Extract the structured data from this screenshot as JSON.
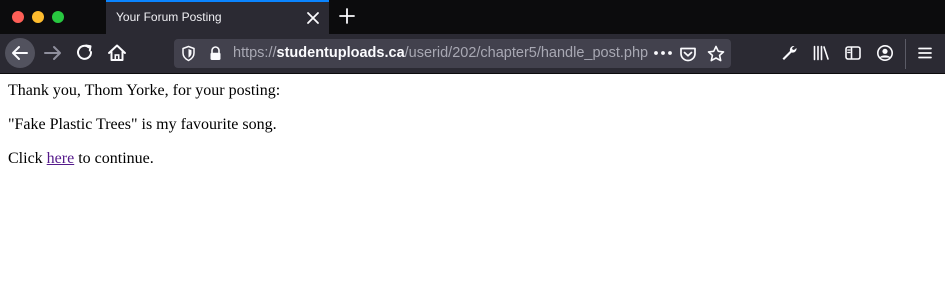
{
  "browser": {
    "tab_title": "Your Forum Posting",
    "url_prefix": "https://",
    "url_host": "studentuploads.ca",
    "url_path": "/userid/202/chapter5/handle_post.php",
    "icons": {
      "back": "back-arrow-icon",
      "forward": "forward-arrow-icon",
      "reload": "reload-icon",
      "home": "home-icon",
      "tracking": "shield-icon",
      "lock": "lock-icon",
      "page_actions": "more-icon",
      "pocket": "pocket-icon",
      "bookmark": "star-icon",
      "tools": "wrench-icon",
      "library": "library-icon",
      "sidebar": "sidebar-icon",
      "account": "account-icon",
      "menu": "hamburger-menu-icon"
    },
    "colors": {
      "accent": "#0a84ff",
      "toolbar": "#2b2a33",
      "titlebar": "#0c0c0d"
    }
  },
  "page": {
    "thanks_prefix": "Thank you, ",
    "user_name": "Thom Yorke",
    "thanks_suffix": ", for your posting:",
    "posting_text": "\"Fake Plastic Trees\" is my favourite song.",
    "continue_prefix": "Click ",
    "continue_link": "here",
    "continue_suffix": " to continue."
  }
}
